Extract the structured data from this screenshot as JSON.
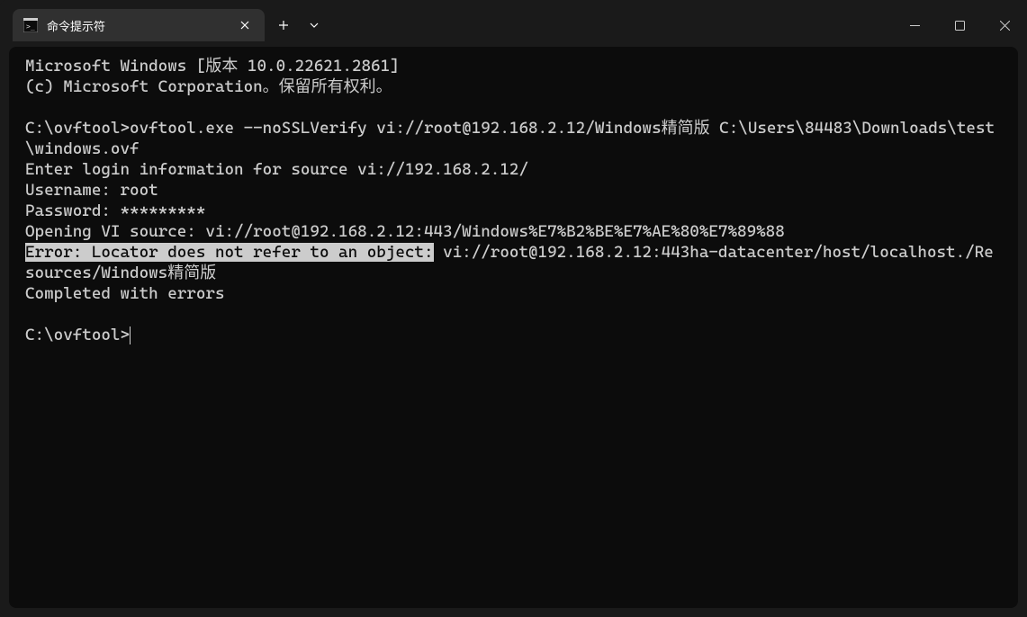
{
  "window": {
    "tab_title": "命令提示符"
  },
  "terminal": {
    "line1": "Microsoft Windows [版本 10.0.22621.2861]",
    "line2": "(c) Microsoft Corporation。保留所有权利。",
    "blank1": "",
    "cmd_line": "C:\\ovftool>ovftool.exe --noSSLVerify vi://root@192.168.2.12/Windows精简版 C:\\Users\\84483\\Downloads\\test\\windows.ovf",
    "enter_login": "Enter login information for source vi://192.168.2.12/",
    "username": "Username: root",
    "password": "Password: *********",
    "opening": "Opening VI source: vi://root@192.168.2.12:443/Windows%E7%B2%BE%E7%AE%80%E7%89%88",
    "error_prefix": "Error: Locator does not refer to an object:",
    "error_rest": " vi://root@192.168.2.12:443ha-datacenter/host/localhost./Resources/Windows精简版",
    "completed": "Completed with errors",
    "blank2": "",
    "prompt": "C:\\ovftool>"
  }
}
